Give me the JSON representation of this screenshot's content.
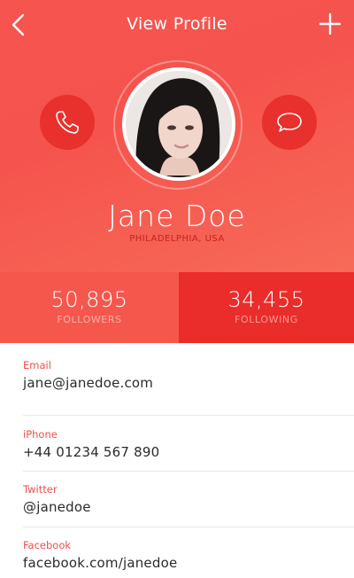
{
  "header": {
    "title": "View Profile"
  },
  "profile": {
    "name": "Jane Doe",
    "location": "PHILADELPHIA, USA"
  },
  "stats": {
    "followers": {
      "value": "50,895",
      "label": "FOLLOWERS"
    },
    "following": {
      "value": "34,455",
      "label": "FOLLOWING"
    }
  },
  "contacts": [
    {
      "label": "Email",
      "value": "jane@janedoe.com"
    },
    {
      "label": "iPhone",
      "value": "+44 01234 567 890"
    },
    {
      "label": "Twitter",
      "value": "@janedoe"
    },
    {
      "label": "Facebook",
      "value": "facebook.com/janedoe"
    }
  ],
  "colors": {
    "accent": "#f5534d",
    "accent_dark": "#e8302c",
    "label_red": "#f04f47"
  },
  "icons": {
    "back": "chevron-left-icon",
    "add": "plus-icon",
    "call": "phone-icon",
    "message": "chat-bubble-icon"
  }
}
